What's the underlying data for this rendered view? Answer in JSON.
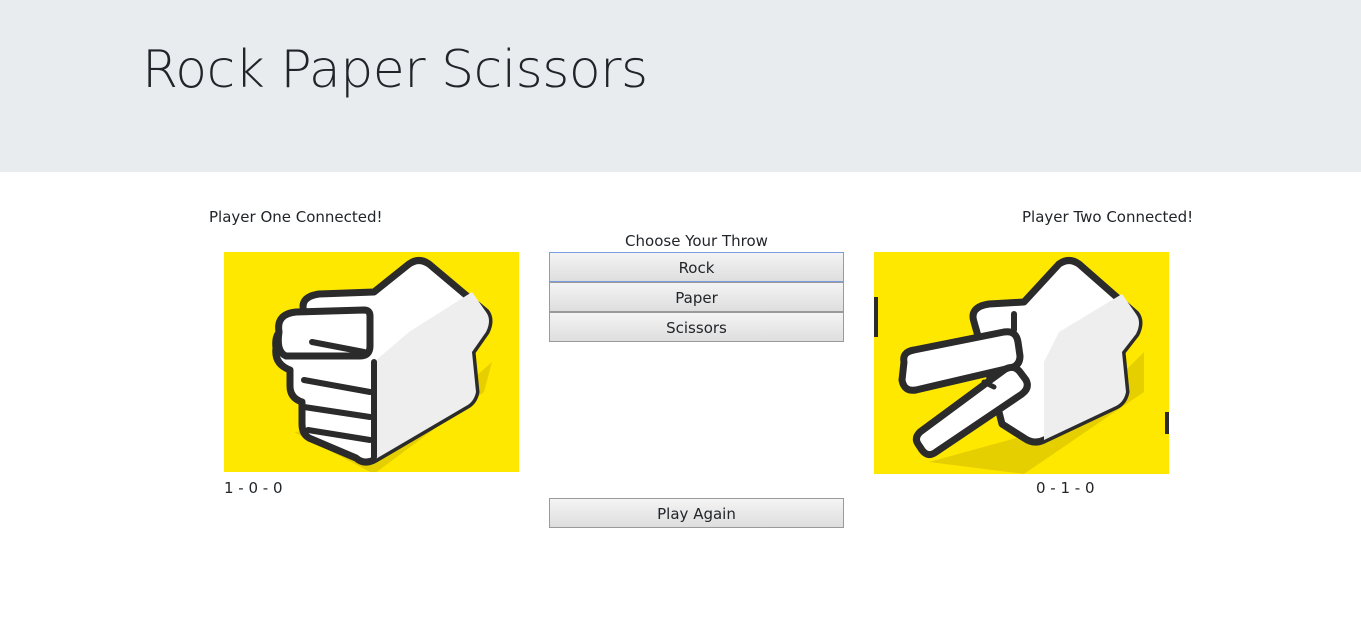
{
  "header": {
    "title": "Rock Paper Scissors"
  },
  "player_one": {
    "status": "Player One Connected!",
    "score": "1 - 0 - 0",
    "throw_icon": "rock-hand-icon"
  },
  "player_two": {
    "status": "Player Two Connected!",
    "score": "0 - 1 - 0",
    "throw_icon": "scissors-hand-icon"
  },
  "controls": {
    "choose_label": "Choose Your Throw",
    "rock_label": "Rock",
    "paper_label": "Paper",
    "scissors_label": "Scissors",
    "play_again_label": "Play Again"
  },
  "colors": {
    "header_bg": "#e9ecef",
    "hand_bg": "#ffe800",
    "focus_border": "#7b9ee0"
  }
}
